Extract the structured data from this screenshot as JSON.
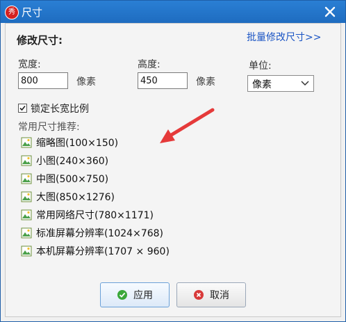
{
  "window": {
    "title": "尺寸",
    "app_icon_glyph": "秀"
  },
  "form": {
    "section_title": "修改尺寸:",
    "batch_link": "批量修改尺寸>>",
    "width_label": "宽度:",
    "width_value": "800",
    "width_unit": "像素",
    "height_label": "高度:",
    "height_value": "450",
    "height_unit": "像素",
    "unit_label": "单位:",
    "unit_selected": "像素",
    "lock_ratio_label": "锁定长宽比例",
    "lock_ratio_checked": true,
    "presets_title": "常用尺寸推荐:"
  },
  "presets": [
    {
      "label": "缩略图(100×150)"
    },
    {
      "label": "小图(240×360)"
    },
    {
      "label": "中图(500×750)"
    },
    {
      "label": "大图(850×1276)"
    },
    {
      "label": "常用网络尺寸(780×1171)"
    },
    {
      "label": "标准屏幕分辨率(1024×768)"
    },
    {
      "label": "本机屏幕分辨率(1707 × 960)"
    }
  ],
  "buttons": {
    "apply": "应用",
    "cancel": "取消"
  },
  "icons": {
    "app": "app-logo-icon",
    "close": "close-icon",
    "preset": "picture-icon",
    "apply": "check-circle-icon",
    "cancel": "x-circle-icon",
    "dropdown": "chevron-down-icon"
  },
  "colors": {
    "titlebar": "#1e6cc0",
    "link": "#1a54c4",
    "annotation_arrow": "#e53a3a",
    "apply_icon": "#3aa83a",
    "cancel_icon": "#d83a3a"
  }
}
